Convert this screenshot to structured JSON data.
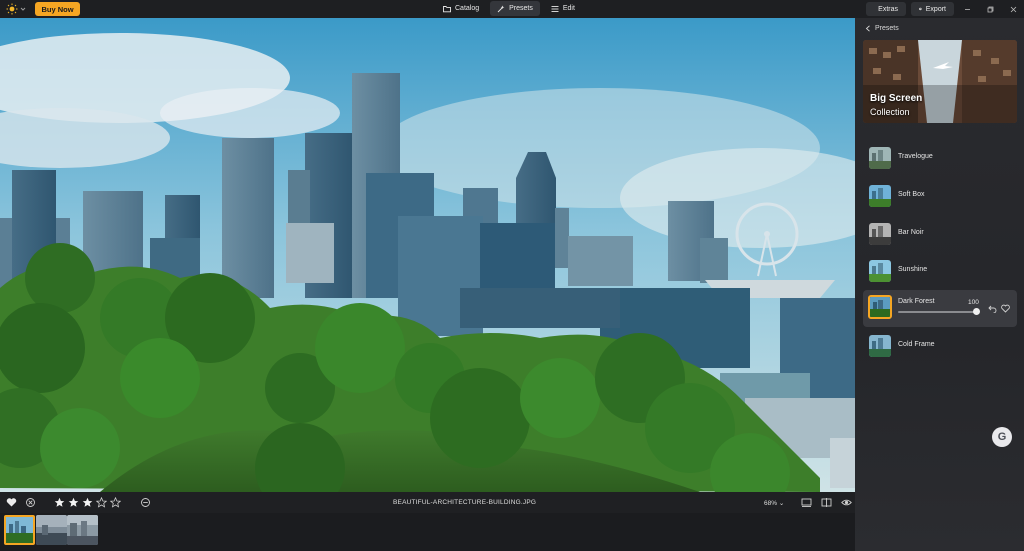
{
  "topbar": {
    "buy_label": "Buy Now",
    "modes": [
      {
        "label": "Catalog",
        "icon": "folder-icon"
      },
      {
        "label": "Presets",
        "icon": "sparkle-icon",
        "active": true
      },
      {
        "label": "Edit",
        "icon": "sliders-icon"
      }
    ],
    "extras_label": "Extras",
    "export_label": "Export"
  },
  "panel": {
    "back_label": "Presets",
    "collection": {
      "title_line1": "Big Screen",
      "title_line2": "Collection"
    },
    "presets": [
      {
        "label": "Travelogue"
      },
      {
        "label": "Soft Box"
      },
      {
        "label": "Bar Noir"
      },
      {
        "label": "Sunshine"
      },
      {
        "label": "Dark Forest",
        "selected": true,
        "amount": "100",
        "amount_fraction": 1.0
      },
      {
        "label": "Cold Frame"
      }
    ]
  },
  "bottombar": {
    "filename": "BEAUTIFUL-ARCHITECTURE-BUILDING.JPG",
    "zoom": "68% ⌄",
    "rating": 3,
    "rating_max": 5
  },
  "filmstrip": {
    "count": 3,
    "selected_index": 0
  },
  "colors": {
    "accent": "#f5a623",
    "panel_bg": "#2a2b2f",
    "topbar_bg": "#1e1f22"
  }
}
